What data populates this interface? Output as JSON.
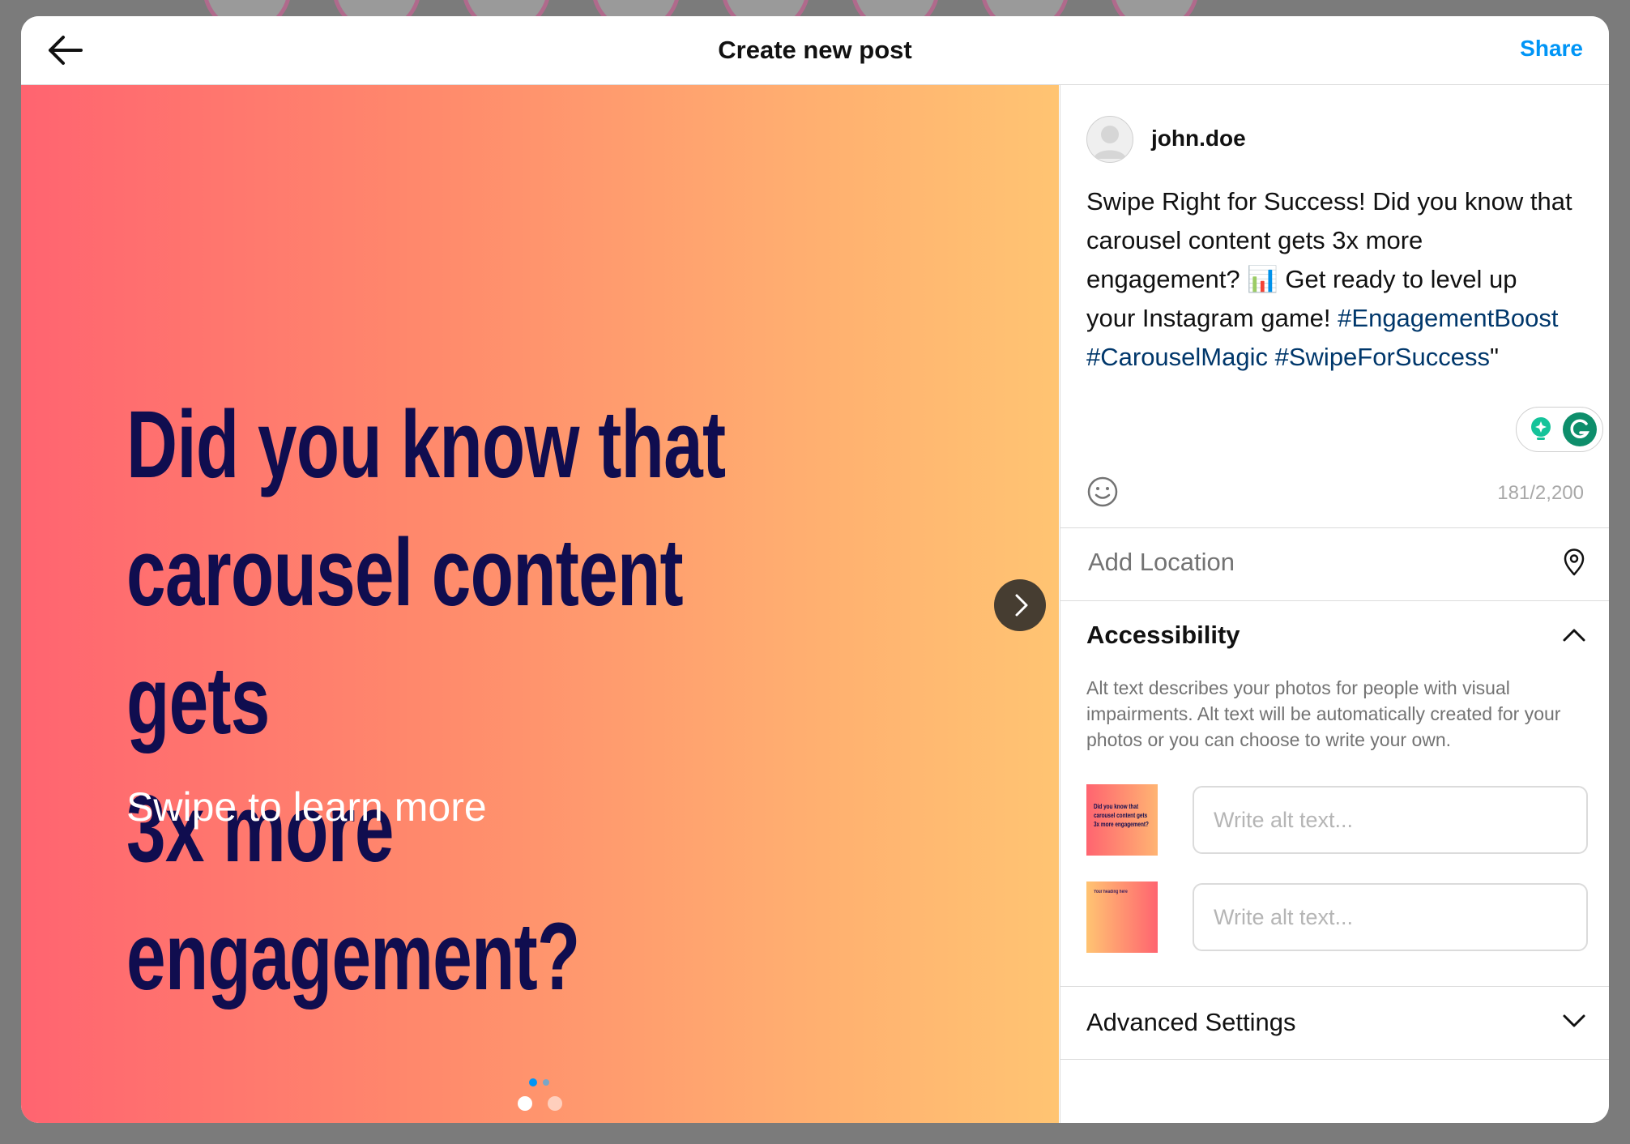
{
  "header": {
    "title": "Create new post",
    "share_label": "Share"
  },
  "media": {
    "headline": "Did you know that\ncarousel content gets\n3x more engagement?",
    "subtext": "Swipe to learn more",
    "slide_count": 2,
    "current_slide": 1
  },
  "post": {
    "username": "john.doe",
    "caption_text": "Swipe Right for Success! Did you know that carousel content gets 3x more engagement? 📊 Get ready to level up your Instagram game!",
    "hashtags": [
      "#EngagementBoost",
      "#CarouselMagic",
      "#SwipeForSuccess"
    ],
    "caption_trailing": "\"",
    "char_count": "181/2,200"
  },
  "location": {
    "label": "Add Location"
  },
  "accessibility": {
    "title": "Accessibility",
    "description": "Alt text describes your photos for people with visual impairments. Alt text will be automatically created for your photos or you can choose to write your own.",
    "thumb1_text": "Did you know that carousel content gets 3x more engagement?",
    "thumb2_text": "Your heading here",
    "alt_placeholder_1": "Write alt text...",
    "alt_placeholder_2": "Write alt text..."
  },
  "advanced": {
    "title": "Advanced Settings"
  },
  "colors": {
    "accent": "#0095f6",
    "hashtag": "#00376b",
    "headline": "#100d4f",
    "gradient_start": "#ff6470",
    "gradient_end": "#ffc472"
  }
}
